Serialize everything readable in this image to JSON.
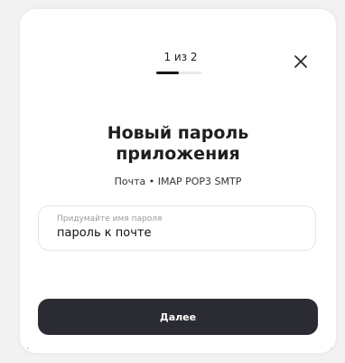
{
  "header": {
    "step_text": "1 из 2",
    "progress_fraction": 0.5,
    "close_icon": "close-icon"
  },
  "main": {
    "title_line1": "Новый пароль",
    "title_line2": "приложения",
    "subtitle": "Почта • IMAP POP3 SMTP"
  },
  "form": {
    "password_name_label": "Придумайте имя пароля",
    "password_name_value": "пароль к почте"
  },
  "footer": {
    "next_label": "Далее"
  },
  "colors": {
    "button_bg": "#2b2c33",
    "progress_fill": "#1a1a1a",
    "progress_track": "#e8e8e8"
  }
}
